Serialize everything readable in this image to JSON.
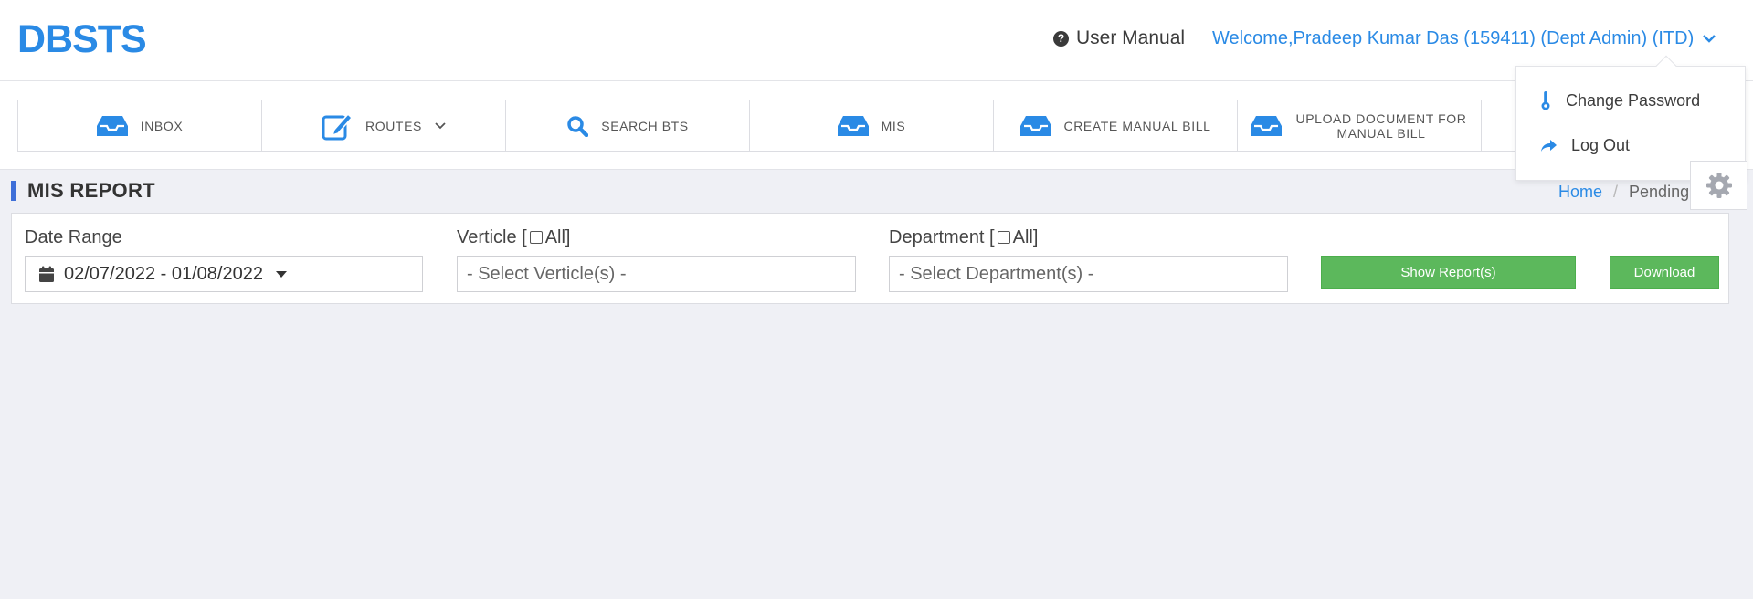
{
  "app": {
    "logo": "DBSTS"
  },
  "header": {
    "user_manual": "User Manual",
    "welcome": "Welcome,Pradeep Kumar Das (159411) (Dept Admin) (ITD)"
  },
  "user_menu": {
    "items": [
      {
        "label": "Change Password",
        "icon": "thermometer-icon"
      },
      {
        "label": "Log Out",
        "icon": "share-arrow-icon"
      }
    ]
  },
  "nav": {
    "items": [
      {
        "label": "INBOX",
        "icon": "inbox-icon"
      },
      {
        "label": "ROUTES",
        "icon": "edit-icon"
      },
      {
        "label": "SEARCH BTS",
        "icon": "search-icon"
      },
      {
        "label": "MIS",
        "icon": "inbox-icon"
      },
      {
        "label": "CREATE MANUAL BILL",
        "icon": "inbox-icon"
      },
      {
        "label": "UPLOAD DOCUMENT FOR MANUAL BILL",
        "icon": "inbox-icon"
      }
    ]
  },
  "page": {
    "title": "MIS REPORT",
    "breadcrumb": {
      "home": "Home",
      "separator": "/",
      "current": "Pending"
    }
  },
  "filters": {
    "date_range": {
      "label": "Date Range",
      "value": "02/07/2022 - 01/08/2022"
    },
    "verticle": {
      "label_prefix": "Verticle [",
      "label_suffix": " All]",
      "placeholder": "- Select Verticle(s) -"
    },
    "department": {
      "label_prefix": "Department [",
      "label_suffix": " All]",
      "placeholder": "- Select Department(s) -"
    },
    "show_report_label": "Show Report(s)",
    "download_label": "Download"
  },
  "colors": {
    "brand": "#2a8ae5",
    "accent_bar": "#3e6fd8",
    "button_green": "#5cb85c",
    "background": "#eff0f5"
  }
}
